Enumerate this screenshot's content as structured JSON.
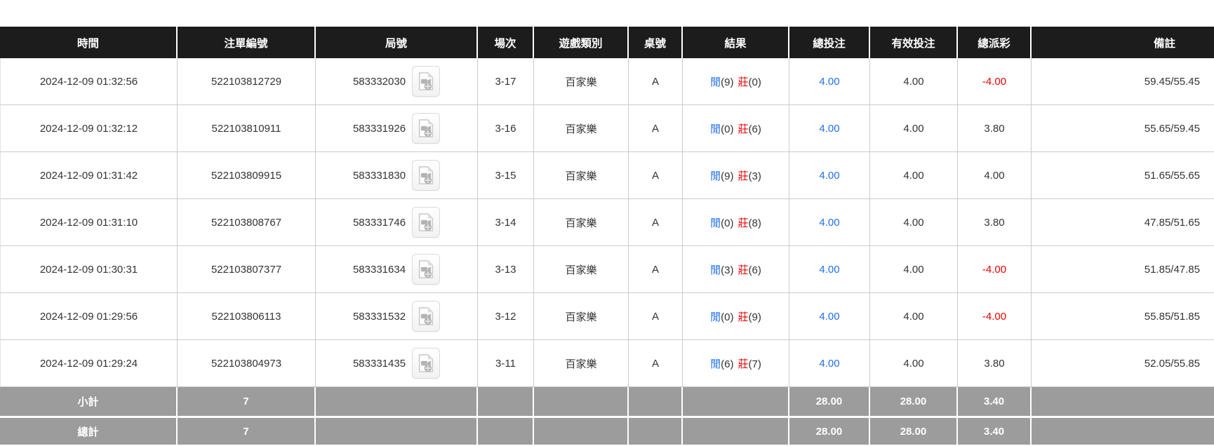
{
  "table": {
    "headers": [
      "時間",
      "注單編號",
      "局號",
      "場次",
      "遊戲類別",
      "桌號",
      "結果",
      "總投注",
      "有效投注",
      "總派彩",
      "備註"
    ],
    "result_labels": {
      "player": "閒",
      "banker": "莊"
    },
    "rows": [
      {
        "time": "2024-12-09 01:32:56",
        "bet_id": "522103812729",
        "round_no": "583332030",
        "session": "3-17",
        "game_type": "百家樂",
        "table_no": "A",
        "player_score": "9",
        "banker_score": "0",
        "total_bet": "4.00",
        "valid_bet": "4.00",
        "payout": "-4.00",
        "remark": "59.45/55.45"
      },
      {
        "time": "2024-12-09 01:32:12",
        "bet_id": "522103810911",
        "round_no": "583331926",
        "session": "3-16",
        "game_type": "百家樂",
        "table_no": "A",
        "player_score": "0",
        "banker_score": "6",
        "total_bet": "4.00",
        "valid_bet": "4.00",
        "payout": "3.80",
        "remark": "55.65/59.45"
      },
      {
        "time": "2024-12-09 01:31:42",
        "bet_id": "522103809915",
        "round_no": "583331830",
        "session": "3-15",
        "game_type": "百家樂",
        "table_no": "A",
        "player_score": "9",
        "banker_score": "3",
        "total_bet": "4.00",
        "valid_bet": "4.00",
        "payout": "4.00",
        "remark": "51.65/55.65"
      },
      {
        "time": "2024-12-09 01:31:10",
        "bet_id": "522103808767",
        "round_no": "583331746",
        "session": "3-14",
        "game_type": "百家樂",
        "table_no": "A",
        "player_score": "0",
        "banker_score": "8",
        "total_bet": "4.00",
        "valid_bet": "4.00",
        "payout": "3.80",
        "remark": "47.85/51.65"
      },
      {
        "time": "2024-12-09 01:30:31",
        "bet_id": "522103807377",
        "round_no": "583331634",
        "session": "3-13",
        "game_type": "百家樂",
        "table_no": "A",
        "player_score": "3",
        "banker_score": "6",
        "total_bet": "4.00",
        "valid_bet": "4.00",
        "payout": "-4.00",
        "remark": "51.85/47.85"
      },
      {
        "time": "2024-12-09 01:29:56",
        "bet_id": "522103806113",
        "round_no": "583331532",
        "session": "3-12",
        "game_type": "百家樂",
        "table_no": "A",
        "player_score": "0",
        "banker_score": "9",
        "total_bet": "4.00",
        "valid_bet": "4.00",
        "payout": "-4.00",
        "remark": "55.85/51.85"
      },
      {
        "time": "2024-12-09 01:29:24",
        "bet_id": "522103804973",
        "round_no": "583331435",
        "session": "3-11",
        "game_type": "百家樂",
        "table_no": "A",
        "player_score": "6",
        "banker_score": "7",
        "total_bet": "4.00",
        "valid_bet": "4.00",
        "payout": "3.80",
        "remark": "52.05/55.85"
      }
    ],
    "footer": [
      {
        "label": "小計",
        "count": "7",
        "total_bet": "28.00",
        "valid_bet": "28.00",
        "payout": "3.40"
      },
      {
        "label": "總計",
        "count": "7",
        "total_bet": "28.00",
        "valid_bet": "28.00",
        "payout": "3.40"
      }
    ]
  },
  "icons": {
    "video_replay": "video-camera-icon"
  },
  "colors": {
    "header_bg": "#1c1c1c",
    "footer_bg": "#9c9c9c",
    "accent_blue": "#1f6ff0",
    "accent_red": "#ec0000",
    "grid_line": "#cbcbcb"
  }
}
